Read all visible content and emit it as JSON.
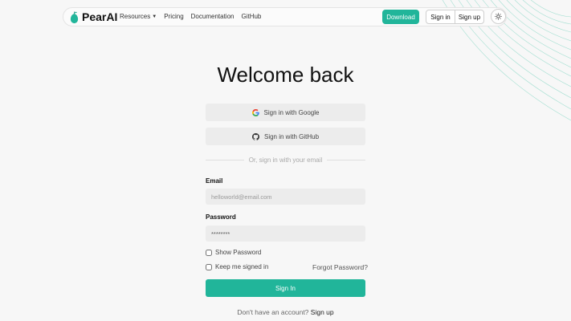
{
  "nav": {
    "brand": "PearAI",
    "links": [
      {
        "label": "Resources",
        "has_menu": true
      },
      {
        "label": "Pricing"
      },
      {
        "label": "Documentation"
      },
      {
        "label": "GitHub"
      }
    ],
    "download_label": "Download",
    "signin_label": "Sign in",
    "signup_label": "Sign up",
    "theme_icon": "sun-icon"
  },
  "main": {
    "title": "Welcome back",
    "google_label": "Sign in with Google",
    "github_label": "Sign in with GitHub",
    "divider_text": "Or, sign in with your email",
    "email_label": "Email",
    "email_placeholder": "helloworld@email.com",
    "password_label": "Password",
    "password_value": "********",
    "show_password_label": "Show Password",
    "keep_signed_in_label": "Keep me signed in",
    "forgot_password_label": "Forgot Password?",
    "submit_label": "Sign In",
    "no_account_text": "Don't have an account?",
    "signup_link": "Sign up"
  },
  "colors": {
    "accent": "#21b59a",
    "background": "#f7f7f7"
  }
}
